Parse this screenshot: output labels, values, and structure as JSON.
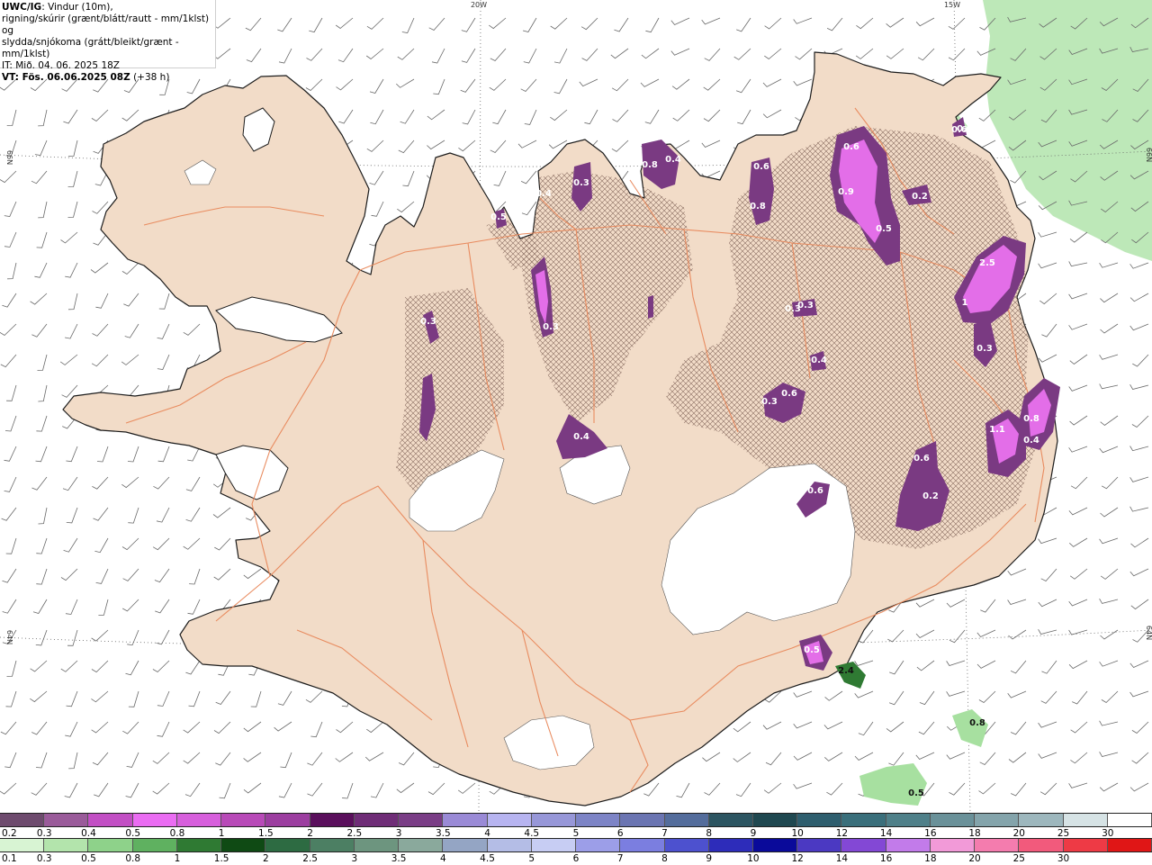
{
  "header": {
    "model": "UWC/IG",
    "line1": ": Vindur (10m),",
    "line2": "rigning/skúrir (grænt/blátt/rautt - mm/1klst) og",
    "line3": "slydda/snjókoma (grátt/bleikt/grænt - mm/1klst)",
    "it": "IT: Mið. 04. 06. 2025 18Z",
    "vt": "VT: Fös. 06.06.2025 08Z",
    "lead": "(+38 h)"
  },
  "graticule_labels": [
    "20W",
    "15W",
    "66N",
    "66N",
    "64N",
    "64N"
  ],
  "colors": {
    "land": "#f2dcc8",
    "roads": "#e8875a",
    "coast": "#222222",
    "glacier": "#ffffff",
    "rain": "#a7e0a0",
    "snow": "#d24fd8",
    "snow_dark": "#7a3a82"
  },
  "precip_labels": [
    {
      "text": "0.6",
      "k": "snow"
    },
    {
      "text": "0.2",
      "k": "snow"
    },
    {
      "text": "0.4",
      "k": "snow"
    },
    {
      "text": "0.3",
      "k": "snow"
    },
    {
      "text": "0.5",
      "k": "snow"
    },
    {
      "text": "0.8",
      "k": "snow"
    },
    {
      "text": "0.4",
      "k": "snow"
    },
    {
      "text": "0.6",
      "k": "snow"
    },
    {
      "text": "0.8",
      "k": "snow"
    },
    {
      "text": "0.6",
      "k": "snow"
    },
    {
      "text": "0.9",
      "k": "snow"
    },
    {
      "text": "0.5",
      "k": "snow"
    },
    {
      "text": "0.2",
      "k": "snow"
    },
    {
      "text": "2.5",
      "k": "snow"
    },
    {
      "text": "1",
      "k": "snow"
    },
    {
      "text": "0.3",
      "k": "snow"
    },
    {
      "text": "0.3",
      "k": "snow"
    },
    {
      "text": "0.3",
      "k": "snow"
    },
    {
      "text": "0.4",
      "k": "snow"
    },
    {
      "text": "0.3",
      "k": "snow"
    },
    {
      "text": "0.6",
      "k": "snow"
    },
    {
      "text": "0.4",
      "k": "snow"
    },
    {
      "text": "0.4",
      "k": "snow"
    },
    {
      "text": "0.8",
      "k": "snow"
    },
    {
      "text": "1.1",
      "k": "snow"
    },
    {
      "text": "0.4",
      "k": "snow"
    },
    {
      "text": "0.6",
      "k": "snow"
    },
    {
      "text": "0.6",
      "k": "snow"
    },
    {
      "text": "0.2",
      "k": "snow"
    },
    {
      "text": "0.3",
      "k": "snow"
    },
    {
      "text": "0.3",
      "k": "snow"
    },
    {
      "text": "0.5",
      "k": "snow"
    },
    {
      "text": "2.4",
      "k": "rain"
    },
    {
      "text": "0.8",
      "k": "rain"
    },
    {
      "text": "0.5",
      "k": "rain"
    }
  ],
  "scale_snow": {
    "labels": [
      "0.2",
      "0.3",
      "0.4",
      "0.5",
      "0.8",
      "1",
      "1.5",
      "2",
      "2.5",
      "3",
      "3.5",
      "4",
      "4.5",
      "5",
      "6",
      "7",
      "8",
      "9",
      "10",
      "12",
      "14",
      "16",
      "18",
      "20",
      "25",
      "30"
    ],
    "colors": [
      "#6e4b6e",
      "#9a5b9a",
      "#c24fc4",
      "#ea6cf2",
      "#d75fdc",
      "#b84ab8",
      "#9c3ea0",
      "#5a0f5c",
      "#6f2d77",
      "#7a3d86",
      "#9a8ad6",
      "#b7b4f0",
      "#9797d8",
      "#7d84c6",
      "#6b75b2",
      "#546d9c",
      "#2c5561",
      "#1f4850",
      "#2e5e6e",
      "#3a6f7b",
      "#4f8089",
      "#6a9199",
      "#84a4ab",
      "#9db7bd",
      "#d6e3e5",
      "#ffffff"
    ]
  },
  "scale_rain": {
    "labels": [
      "0.1",
      "0.3",
      "0.5",
      "0.8",
      "1",
      "1.5",
      "2",
      "2.5",
      "3",
      "3.5",
      "4",
      "4.5",
      "5",
      "6",
      "7",
      "8",
      "9",
      "10",
      "12",
      "14",
      "16",
      "18",
      "20",
      "25",
      "30"
    ],
    "colors": [
      "#d8f4d3",
      "#b3e4ac",
      "#8ed28a",
      "#5fb160",
      "#2f7a33",
      "#0f4a14",
      "#2d6b42",
      "#4c7f63",
      "#6d957f",
      "#8aa99c",
      "#94a5c4",
      "#b4bde6",
      "#c7cdf3",
      "#9c9ee8",
      "#7b7ee0",
      "#4d51cf",
      "#2d2cba",
      "#0a0a9a",
      "#4b39c2",
      "#8348d5",
      "#c27bea",
      "#f29ad8",
      "#f47cae",
      "#f25a7c",
      "#ee3a45",
      "#e01616"
    ]
  }
}
